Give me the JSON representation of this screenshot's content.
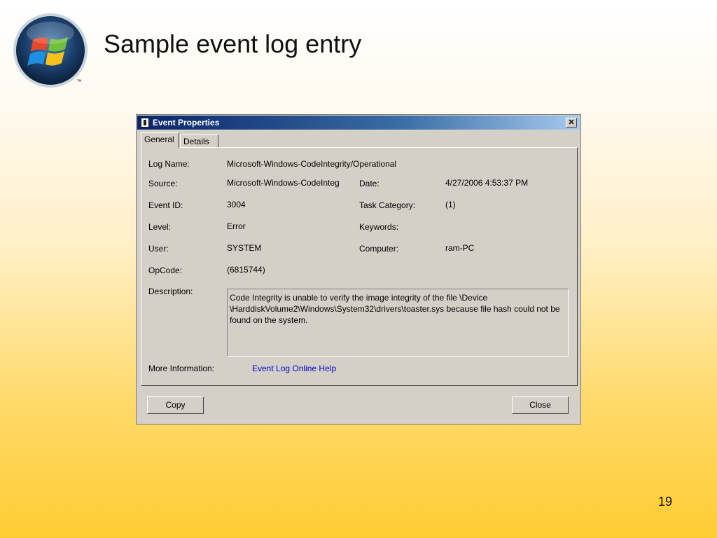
{
  "slide": {
    "title": "Sample event log entry",
    "page_number": "19",
    "logo_icon": "windows-logo-icon",
    "logo_trademark": "™"
  },
  "dialog": {
    "title": "Event Properties",
    "close_glyph": "✕",
    "tabs": [
      {
        "label": "General",
        "active": true
      },
      {
        "label": "Details",
        "active": false
      }
    ],
    "fields": {
      "log_name_label": "Log Name:",
      "log_name_value": "Microsoft-Windows-CodeIntegrity/Operational",
      "source_label": "Source:",
      "source_value": "Microsoft-Windows-CodeInteg",
      "date_label": "Date:",
      "date_value": "4/27/2006 4:53:37 PM",
      "event_id_label": "Event ID:",
      "event_id_value": "3004",
      "task_category_label": "Task Category:",
      "task_category_value": "(1)",
      "level_label": "Level:",
      "level_value": "Error",
      "keywords_label": "Keywords:",
      "keywords_value": "",
      "user_label": "User:",
      "user_value": "SYSTEM",
      "computer_label": "Computer:",
      "computer_value": "ram-PC",
      "opcode_label": "OpCode:",
      "opcode_value": "(6815744)",
      "description_label": "Description:",
      "description_value": "Code Integrity is unable to verify the image integrity of the file \\Device\n\\HarddiskVolume2\\Windows\\System32\\drivers\\toaster.sys because file hash could not be found on the system.",
      "more_info_label": "More Information:",
      "more_info_link": "Event Log Online Help"
    },
    "buttons": {
      "copy_label": "Copy",
      "close_label": "Close"
    }
  }
}
